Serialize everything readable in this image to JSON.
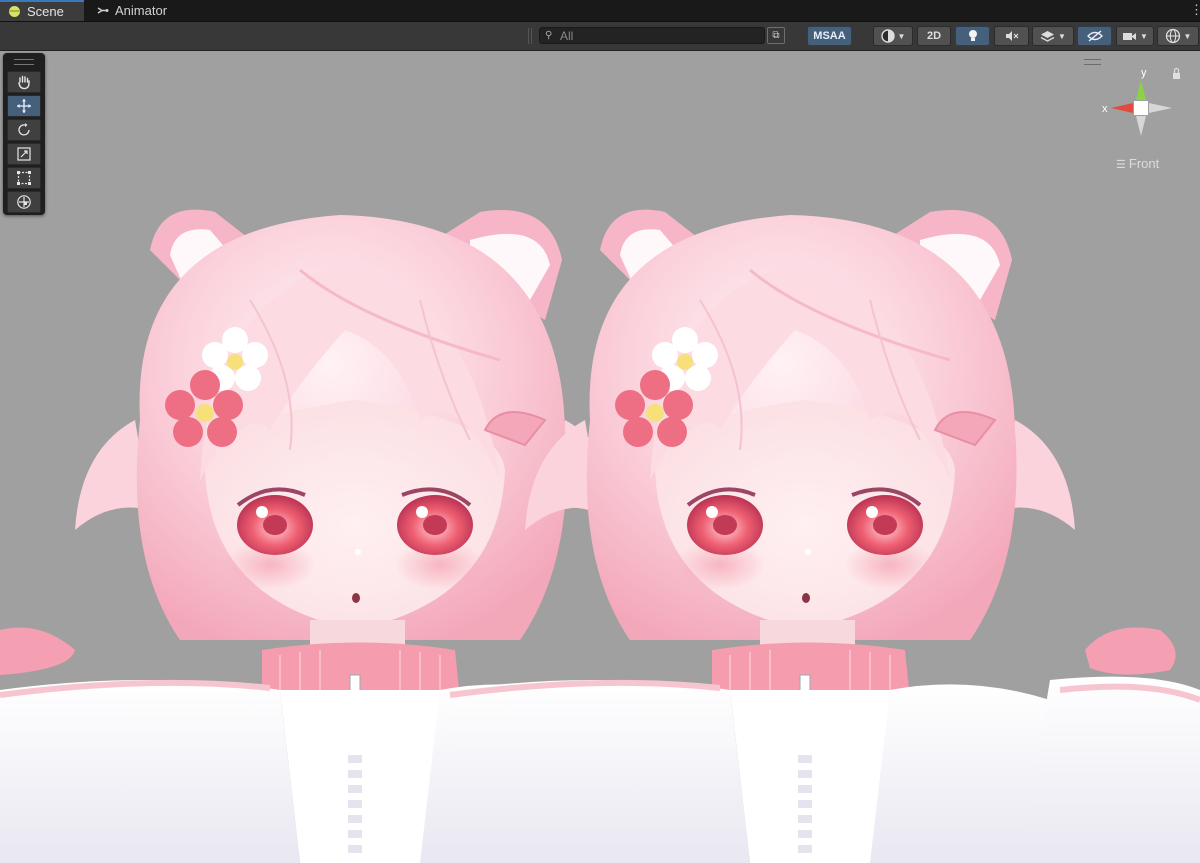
{
  "tabs": {
    "scene": "Scene",
    "animator": "Animator"
  },
  "toolbar": {
    "search_placeholder": "All",
    "msaa_label": "MSAA",
    "mode_2d_label": "2D"
  },
  "tools": [
    "hand-tool",
    "move-tool",
    "rotate-tool",
    "scale-tool",
    "rect-tool",
    "transform-tool"
  ],
  "gizmo": {
    "axis_x": "x",
    "axis_y": "y",
    "view": "Front"
  },
  "colors": {
    "accent_active": "#46607c",
    "tab_accent": "#3a79bb",
    "background": "#a0a0a0",
    "hair": "#f8c3cf",
    "flower_red": "#ee6f84",
    "jacket": "#fbf8fb"
  },
  "scene_content": {
    "character_count": 2
  }
}
